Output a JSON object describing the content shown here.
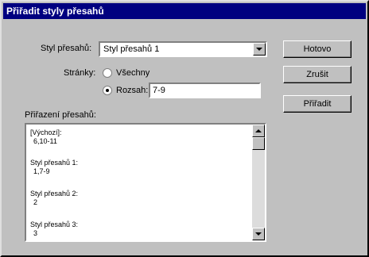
{
  "window": {
    "title": "Přiřadit styly přesahů"
  },
  "form": {
    "style_label": "Styl přesahů:",
    "style_value": "Styl přesahů 1",
    "pages_label": "Stránky:",
    "radio_all": "Všechny",
    "radio_range": "Rozsah:",
    "range_value": "7-9",
    "assignment_label": "Přiřazení přesahů:"
  },
  "assignments": [
    {
      "name": "[Výchozí]:",
      "pages": "6,10-11"
    },
    {
      "name": "Styl přesahů 1:",
      "pages": "1,7-9"
    },
    {
      "name": "Styl přesahů 2:",
      "pages": "2"
    },
    {
      "name": "Styl přesahů 3:",
      "pages": "3"
    }
  ],
  "buttons": {
    "ok": "Hotovo",
    "cancel": "Zrušit",
    "assign": "Přiřadit"
  }
}
